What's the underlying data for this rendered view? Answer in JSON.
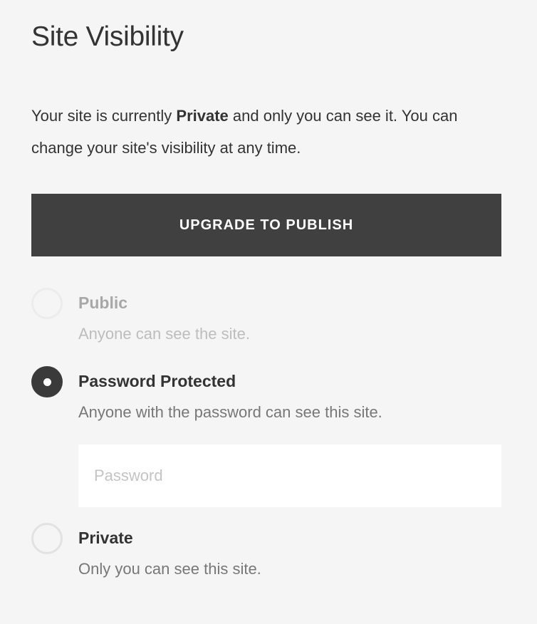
{
  "title": "Site Visibility",
  "description": {
    "prefix": "Your site is currently ",
    "status": "Private",
    "suffix": " and only you can see it. You can change your site's visibility at any time."
  },
  "upgrade_button": "UPGRADE TO PUBLISH",
  "options": [
    {
      "label": "Public",
      "description": "Anyone can see the site.",
      "selected": false,
      "disabled": true
    },
    {
      "label": "Password Protected",
      "description": "Anyone with the password can see this site.",
      "selected": true,
      "disabled": false
    },
    {
      "label": "Private",
      "description": "Only you can see this site.",
      "selected": false,
      "disabled": false
    }
  ],
  "password_field": {
    "placeholder": "Password",
    "value": ""
  },
  "colors": {
    "background": "#f5f5f5",
    "button": "#404040",
    "text": "#333333",
    "muted": "#777777"
  }
}
